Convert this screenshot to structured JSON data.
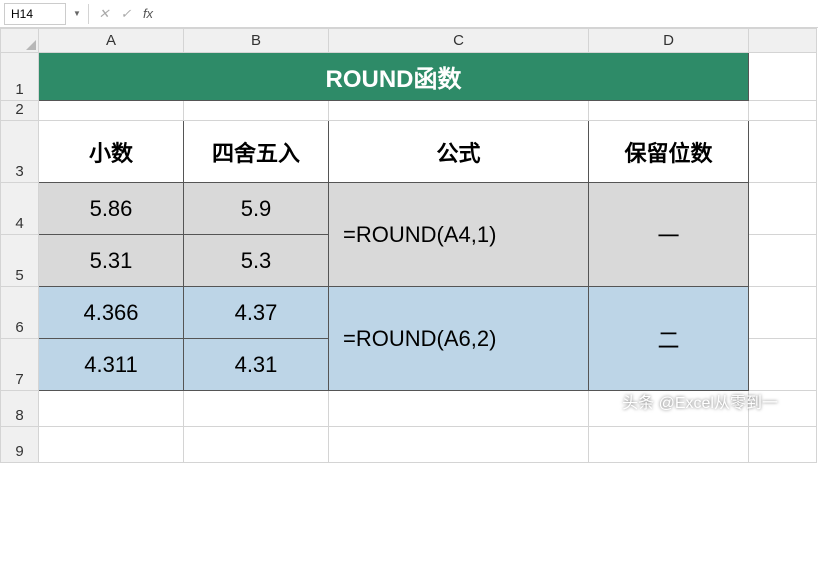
{
  "formula_bar": {
    "name_box": "H14",
    "cancel": "✕",
    "confirm": "✓",
    "fx": "fx",
    "input": ""
  },
  "columns": [
    "A",
    "B",
    "C",
    "D"
  ],
  "rows": [
    "1",
    "2",
    "3",
    "4",
    "5",
    "6",
    "7",
    "8",
    "9"
  ],
  "title": "ROUND函数",
  "headers": {
    "decimal": "小数",
    "rounded": "四舍五入",
    "formula": "公式",
    "digits": "保留位数"
  },
  "data": {
    "r4": {
      "a": "5.86",
      "b": "5.9"
    },
    "r5": {
      "a": "5.31",
      "b": "5.3"
    },
    "r6": {
      "a": "4.366",
      "b": "4.37"
    },
    "r7": {
      "a": "4.311",
      "b": "4.31"
    },
    "formula1": "=ROUND(A4,1)",
    "formula2": "=ROUND(A6,2)",
    "digits1": "一",
    "digits2": "二"
  },
  "watermark": "头条 @Excel从零到一"
}
